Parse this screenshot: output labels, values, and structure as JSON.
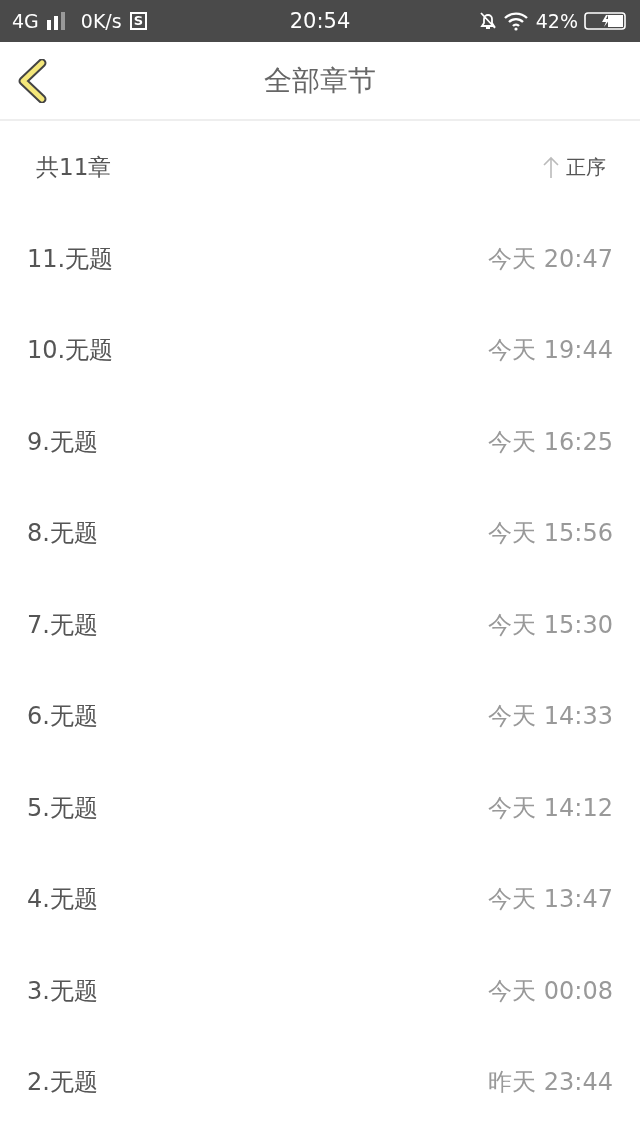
{
  "status_bar": {
    "network": "4G",
    "speed": "0K/s",
    "app_badge": "S",
    "time": "20:54",
    "battery": "42%"
  },
  "header": {
    "title": "全部章节"
  },
  "summary": {
    "count": "共11章",
    "sort": "正序"
  },
  "chapters": [
    {
      "title": "11.无题",
      "time": "今天 20:47"
    },
    {
      "title": "10.无题",
      "time": "今天 19:44"
    },
    {
      "title": "9.无题",
      "time": "今天 16:25"
    },
    {
      "title": "8.无题",
      "time": "今天 15:56"
    },
    {
      "title": "7.无题",
      "time": "今天 15:30"
    },
    {
      "title": "6.无题",
      "time": "今天 14:33"
    },
    {
      "title": "5.无题",
      "time": "今天 14:12"
    },
    {
      "title": "4.无题",
      "time": "今天 13:47"
    },
    {
      "title": "3.无题",
      "time": "今天 00:08"
    },
    {
      "title": "2.无题",
      "time": "昨天 23:44"
    }
  ]
}
